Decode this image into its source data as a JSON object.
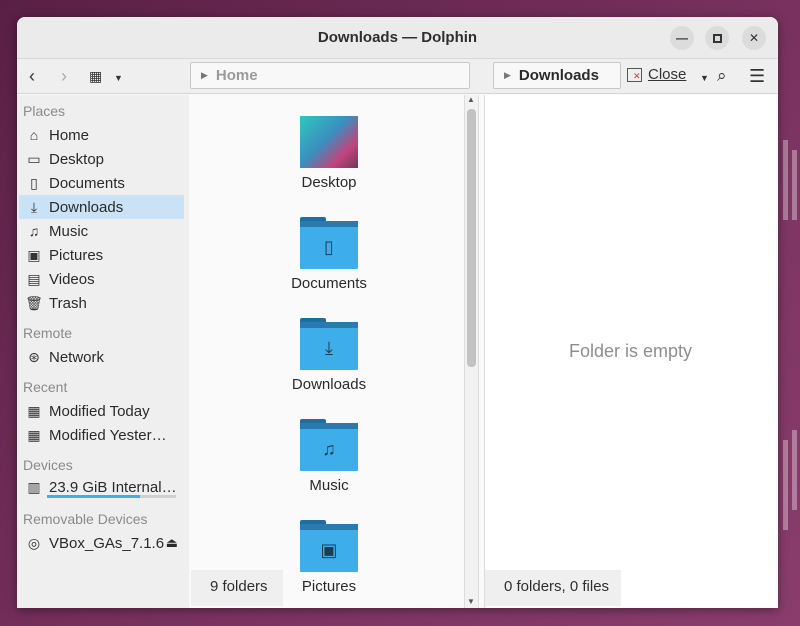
{
  "window": {
    "title": "Downloads — Dolphin"
  },
  "toolbar": {
    "left_crumb": "Home",
    "right_crumb": "Downloads",
    "close_label": "Close"
  },
  "sidebar": {
    "places_header": "Places",
    "places": [
      {
        "label": "Home",
        "icon": "home-icon"
      },
      {
        "label": "Desktop",
        "icon": "desktop-icon"
      },
      {
        "label": "Documents",
        "icon": "documents-icon"
      },
      {
        "label": "Downloads",
        "icon": "downloads-icon"
      },
      {
        "label": "Music",
        "icon": "music-icon"
      },
      {
        "label": "Pictures",
        "icon": "pictures-icon"
      },
      {
        "label": "Videos",
        "icon": "videos-icon"
      },
      {
        "label": "Trash",
        "icon": "trash-icon"
      }
    ],
    "remote_header": "Remote",
    "remote": [
      {
        "label": "Network",
        "icon": "network-icon"
      }
    ],
    "recent_header": "Recent",
    "recent": [
      {
        "label": "Modified Today",
        "icon": "calendar-icon"
      },
      {
        "label": "Modified Yester…",
        "icon": "calendar-icon"
      }
    ],
    "devices_header": "Devices",
    "devices": [
      {
        "label": "23.9 GiB Internal…",
        "icon": "drive-icon",
        "usage": 0.72
      }
    ],
    "removable_header": "Removable Devices",
    "removable": [
      {
        "label": "VBox_GAs_7.1.6",
        "icon": "optical-disc-icon"
      }
    ]
  },
  "left_pane": {
    "items": [
      {
        "label": "Desktop"
      },
      {
        "label": "Documents"
      },
      {
        "label": "Downloads"
      },
      {
        "label": "Music"
      },
      {
        "label": "Pictures"
      }
    ],
    "status": "9 folders"
  },
  "right_pane": {
    "empty_text": "Folder is empty",
    "status": "0 folders, 0 files"
  },
  "colors": {
    "accent": "#3daee9",
    "selection": "#c9e2f5"
  }
}
